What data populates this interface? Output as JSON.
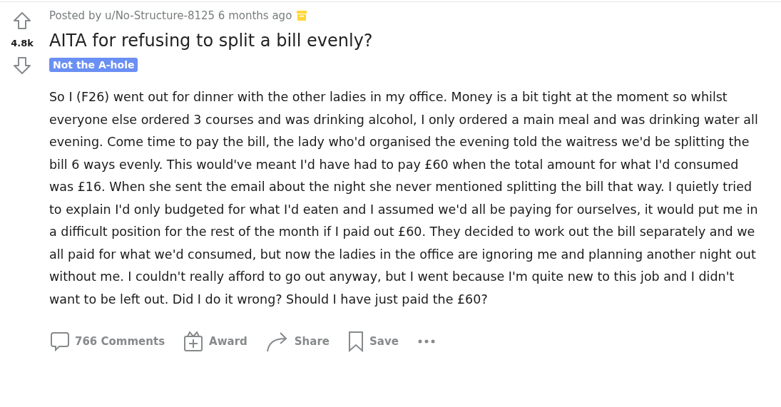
{
  "vote": {
    "score": "4.8k"
  },
  "post": {
    "byline": "Posted by u/No-Structure-8125 6 months ago",
    "archived": true,
    "title": "AITA for refusing to split a bill evenly?",
    "flair": {
      "label": "Not the A-hole",
      "color": "#6a8ff5"
    },
    "body": "So I (F26) went out for dinner with the other ladies in my office. Money is a bit tight at the moment so whilst everyone else ordered 3 courses and was drinking alcohol, I only ordered a main meal and was drinking water all evening. Come time to pay the bill, the lady who'd organised the evening told the waitress we'd be splitting the bill 6 ways evenly. This would've meant I'd have had to pay £60 when the total amount for what I'd consumed was £16. When she sent the email about the night she never mentioned splitting the bill that way. I quietly tried to explain I'd only budgeted for what I'd eaten and I assumed we'd all be paying for ourselves, it would put me in a difficult position for the rest of the month if I paid out £60. They decided to work out the bill separately and we all paid for what we'd consumed, but now the ladies in the office are ignoring me and planning another night out without me. I couldn't really afford to go out anyway, but I went because I'm quite new to this job and I didn't want to be left out. Did I do it wrong? Should I have just paid the £60?"
  },
  "actions": [
    {
      "kind": "comments",
      "label": "766 Comments"
    },
    {
      "kind": "award",
      "label": "Award"
    },
    {
      "kind": "share",
      "label": "Share"
    },
    {
      "kind": "save",
      "label": "Save"
    },
    {
      "kind": "more"
    }
  ]
}
